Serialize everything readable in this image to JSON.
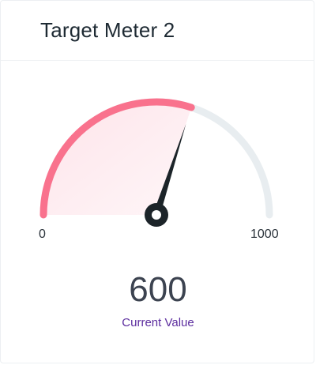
{
  "card": {
    "title": "Target Meter 2"
  },
  "gauge": {
    "min": 0,
    "max": 1000,
    "value": 600,
    "min_label": "0",
    "max_label": "1000",
    "value_text": "600",
    "value_caption": "Current Value",
    "colors": {
      "filled_arc": "#f9728d",
      "filled_area": "#fde9ee",
      "track": "#e8edf0",
      "needle": "#1c2429",
      "pivot": "#1c2429",
      "pivot_inner": "#ffffff",
      "value_text": "#3c4350",
      "caption_text": "#5b2c9e"
    }
  }
}
